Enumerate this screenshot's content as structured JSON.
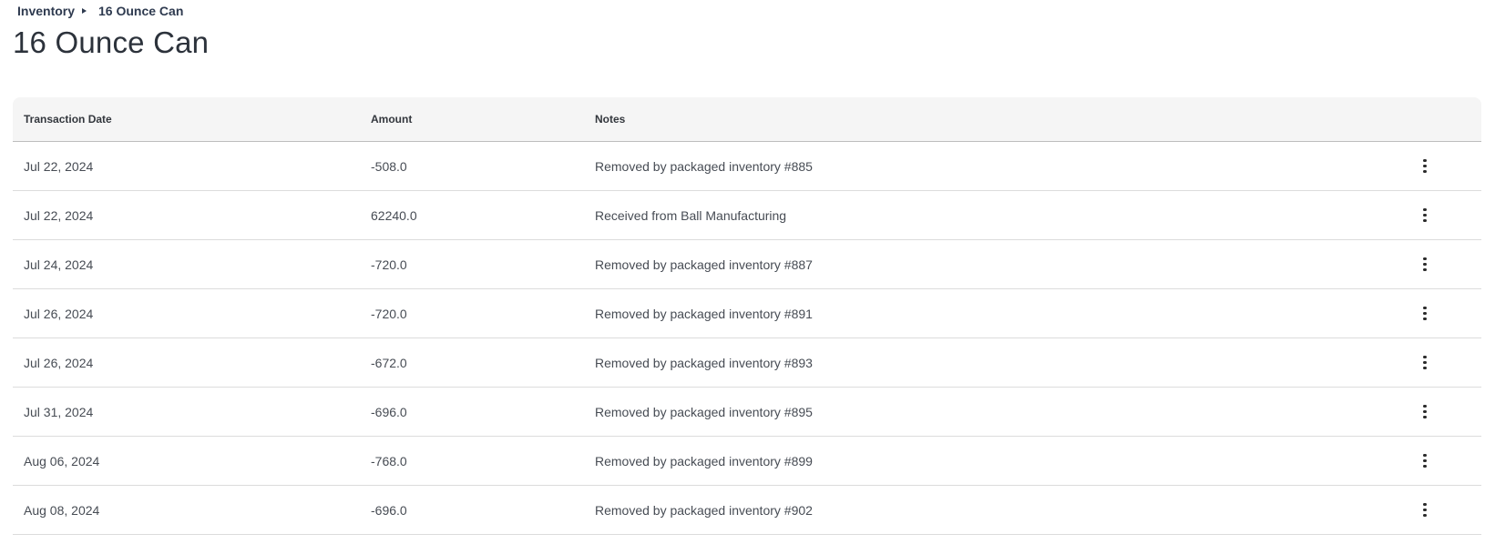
{
  "breadcrumb": {
    "parent": "Inventory",
    "current": "16 Ounce Can"
  },
  "page_title": "16 Ounce Can",
  "table": {
    "headers": {
      "date": "Transaction Date",
      "amount": "Amount",
      "notes": "Notes"
    },
    "rows": [
      {
        "date": "Jul 22, 2024",
        "amount": "-508.0",
        "notes": "Removed by packaged inventory #885"
      },
      {
        "date": "Jul 22, 2024",
        "amount": "62240.0",
        "notes": "Received from Ball Manufacturing"
      },
      {
        "date": "Jul 24, 2024",
        "amount": "-720.0",
        "notes": "Removed by packaged inventory #887"
      },
      {
        "date": "Jul 26, 2024",
        "amount": "-720.0",
        "notes": "Removed by packaged inventory #891"
      },
      {
        "date": "Jul 26, 2024",
        "amount": "-672.0",
        "notes": "Removed by packaged inventory #893"
      },
      {
        "date": "Jul 31, 2024",
        "amount": "-696.0",
        "notes": "Removed by packaged inventory #895"
      },
      {
        "date": "Aug 06, 2024",
        "amount": "-768.0",
        "notes": "Removed by packaged inventory #899"
      },
      {
        "date": "Aug 08, 2024",
        "amount": "-696.0",
        "notes": "Removed by packaged inventory #902"
      }
    ],
    "row_action_icon": "more-vertical-icon"
  }
}
